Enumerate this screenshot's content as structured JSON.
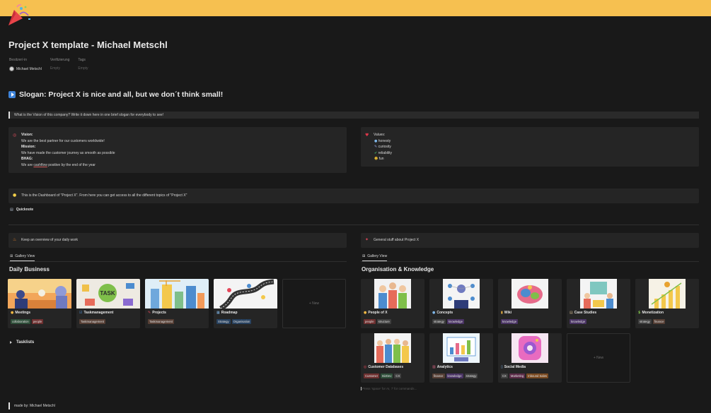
{
  "colors": {
    "cover": "#f6c050",
    "background": "#191919",
    "callout": "#252525",
    "tag_orange": "#7a4a21",
    "tag_red": "#6e3030",
    "tag_blue": "#27415f",
    "tag_purple": "#4a3464",
    "tag_brown": "#563f35",
    "tag_green": "#2f4f3a",
    "tag_gray": "#3f3f3f",
    "tag_pink": "#5c2c48"
  },
  "page": {
    "title": "Project X template - Michael Metschl",
    "icon": "party-popper-icon"
  },
  "properties": {
    "owner_label": "Besitzer/-in",
    "owner_value": "Michael Metschl",
    "verify_label": "Verifizierung",
    "verify_value": "Empty",
    "tags_label": "Tags",
    "tags_value": "Empty"
  },
  "slogan": {
    "text": "Slogan: Project X is nice and all, but we don´t think small!"
  },
  "vision_quote": "What is the Vision of this company? Write it down here in one brief slogan for everybody to see!",
  "vision_callout": {
    "vision_label": "Vision:",
    "vision_text": "We are the best partner for our customers worldwide!",
    "mission_label": "Mission:",
    "mission_text": "We have made the customer journey as smooth as possible",
    "bhag_label": "BHAG:",
    "bhag_text_a": "We are ",
    "bhag_text_b": "cashflow",
    "bhag_text_c": " positive by the end of the year"
  },
  "values_callout": {
    "label": "Values:",
    "items": [
      "honesty",
      "curiosity",
      "reliability",
      "fun"
    ]
  },
  "dashboard_callout": "This is the Dashboard of \"Project X\". From here you can get access to all the different topics of \"Project X\"",
  "quicknote": "Quicknote",
  "daily_callout": "Keep an overview of your daily work",
  "general_callout": "General stuff about Project X",
  "gallery_view": "Gallery View",
  "daily_business": {
    "title": "Daily Business",
    "cards": [
      {
        "name": "Meetings",
        "tags": [
          "collaboration",
          "people"
        ]
      },
      {
        "name": "Taskmanagement",
        "tags": [
          "Taskmanagement"
        ]
      },
      {
        "name": "Projects",
        "tags": [
          "Taskmanagement"
        ]
      },
      {
        "name": "Roadmap",
        "tags": [
          "Strategy",
          "Organisation"
        ]
      }
    ],
    "new_label": "+ New"
  },
  "org_knowledge": {
    "title": "Organisation & Knowledge",
    "cards": [
      {
        "name": "People of X",
        "tags": [
          "people",
          "structure"
        ]
      },
      {
        "name": "Concepts",
        "tags": [
          "strategy",
          "knowledge"
        ]
      },
      {
        "name": "Wiki",
        "tags": [
          "knowledge"
        ]
      },
      {
        "name": "Case Studies",
        "tags": [
          "knowledge"
        ]
      },
      {
        "name": "Monetization",
        "tags": [
          "strategy",
          "finance"
        ]
      },
      {
        "name": "Customer Databases",
        "tags": [
          "Customer",
          "BizDev",
          "CX"
        ]
      },
      {
        "name": "Analytics",
        "tags": [
          "finance",
          "knowledge",
          "strategy"
        ]
      },
      {
        "name": "Social Media",
        "tags": [
          "CX",
          "Marketing",
          "Inbound Sales"
        ]
      }
    ],
    "new_label": "+ New"
  },
  "task_text": "TASK",
  "tasklists": "Tasklists",
  "hint": "Press 'space' for AI, '/' for commands...",
  "footer": "made by: Michael Metschl"
}
